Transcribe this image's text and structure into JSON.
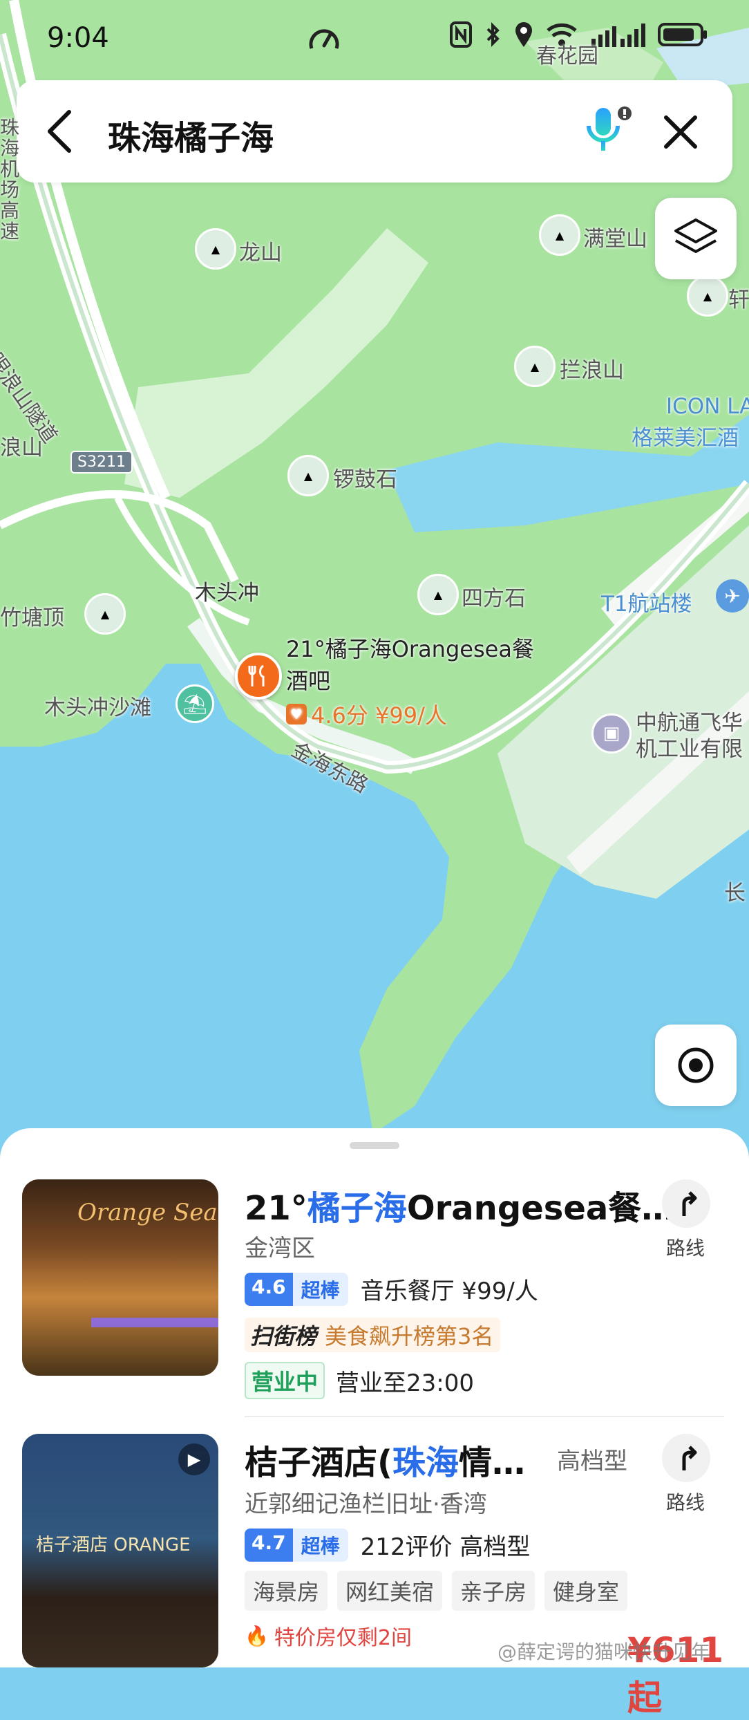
{
  "status_bar": {
    "time": "9:04"
  },
  "search": {
    "query": "珠海橘子海"
  },
  "map": {
    "labels": {
      "airport_expressway": "珠海机场高速",
      "tunnel_road": "眼浪山隧道",
      "shan_left": "浪山",
      "chunhua_garden": "春花园",
      "longshan": "龙山",
      "mantangshan": "满堂山",
      "lanlangshan": "拦浪山",
      "icon": "ICON LA",
      "grande_hotel": "格莱美汇酒",
      "luogushi": "锣鼓石",
      "s3211": "S3211",
      "mutouchong": "木头冲",
      "sifangshi": "四方石",
      "t1_terminal": "T1航站楼",
      "zhutangding": "竹塘顶",
      "mutouchong_beach": "木头冲沙滩",
      "jinhai_east_road": "金海东路",
      "avic_1": "中航通飞华",
      "avic_2": "机工业有限",
      "zhang": "长",
      "xuan": "轩"
    },
    "poi": {
      "name_line1": "21°橘子海Orangesea餐",
      "name_line2": "酒吧",
      "rating": "4.6分 ¥99/人"
    }
  },
  "results": [
    {
      "title_pre": "21°",
      "title_hl": "橘子海",
      "title_post": "Orangesea餐…",
      "district": "金湾区",
      "score": "4.6",
      "score_label": "超棒",
      "category_price": "音乐餐厅 ¥99/人",
      "rank_badge": "扫街榜",
      "rank_text": "美食飙升榜第3名",
      "open_status": "营业中",
      "hours": "营业至23:00",
      "route_label": "路线",
      "thumb_sign": "Orange Sea"
    },
    {
      "title_pre": "桔子酒店(",
      "title_hl": "珠海",
      "title_post": "情…",
      "grade": "高档型",
      "address": "近郭细记渔栏旧址·香湾",
      "score": "4.7",
      "score_label": "超棒",
      "reviews_grade": "212评价 高档型",
      "tags": [
        "海景房",
        "网红美宿",
        "亲子房",
        "健身室"
      ],
      "promo": "特价房仅剩2间",
      "price_partial": "¥611起",
      "route_label": "路线",
      "thumb_sign": "桔子酒店 ORANGE"
    }
  ],
  "watermark": "@薛定谔的猫咪快升见年"
}
